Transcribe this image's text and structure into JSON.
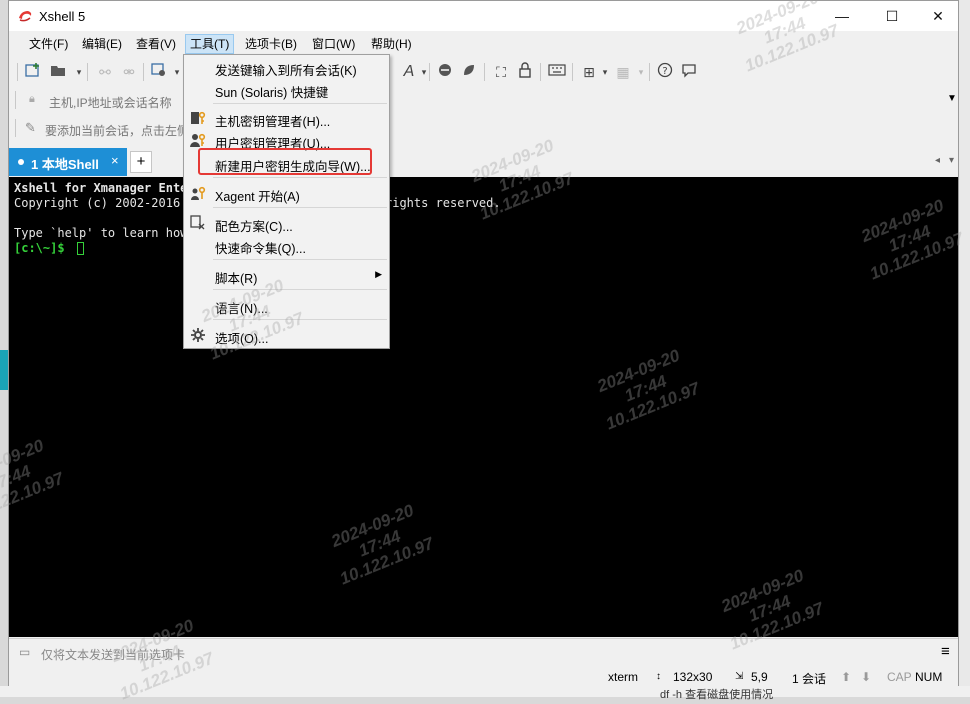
{
  "window": {
    "title": "Xshell 5",
    "controls": {
      "minimize": "—",
      "maximize": "☐",
      "close": "✕"
    }
  },
  "menubar": [
    {
      "label": "文件(F)"
    },
    {
      "label": "编辑(E)"
    },
    {
      "label": "查看(V)"
    },
    {
      "label": "工具(T)"
    },
    {
      "label": "选项卡(B)"
    },
    {
      "label": "窗口(W)"
    },
    {
      "label": "帮助(H)"
    }
  ],
  "address": {
    "placeholder": "主机,IP地址或会话名称"
  },
  "hint": {
    "text": "要添加当前会话，点击左侧"
  },
  "tabs": {
    "active_label": "1 本地Shell",
    "close": "×",
    "add": "+"
  },
  "terminal": {
    "line1": "Xshell for Xmanager Ente",
    "line1b": "",
    "line2": "Copyright (c) 2002-2016 N",
    "line2b": "rights reserved.",
    "line3": "Type `help' to learn how",
    "prompt": "[c:\\~]$ "
  },
  "dropdown": {
    "items": [
      {
        "label": "发送键输入到所有会话(K)"
      },
      {
        "label": "Sun (Solaris) 快捷键"
      },
      {
        "label": "主机密钥管理者(H)..."
      },
      {
        "label": "用户密钥管理者(U)..."
      },
      {
        "label": "新建用户密钥生成向导(W)..."
      },
      {
        "label": "Xagent 开始(A)"
      },
      {
        "label": "配色方案(C)..."
      },
      {
        "label": "快速命令集(Q)..."
      },
      {
        "label": "脚本(R)"
      },
      {
        "label": "语言(N)..."
      },
      {
        "label": "选项(O)..."
      }
    ]
  },
  "sendbar": {
    "placeholder": "仅将文本发送到当前选项卡"
  },
  "statusbar": {
    "term": "xterm",
    "size": "132x30",
    "cursor": "5,9",
    "sessions": "1 会话",
    "cap": "CAP",
    "num": "NUM"
  },
  "background": {
    "bottom_text": "df -h    查看磁盘使用情况"
  },
  "watermark": {
    "text": "2024-09-20\n17:44\n10.122.10.97"
  },
  "colors": {
    "tab_active": "#1e8fd6",
    "highlight": "#e53935",
    "prompt": "#35d13a"
  }
}
